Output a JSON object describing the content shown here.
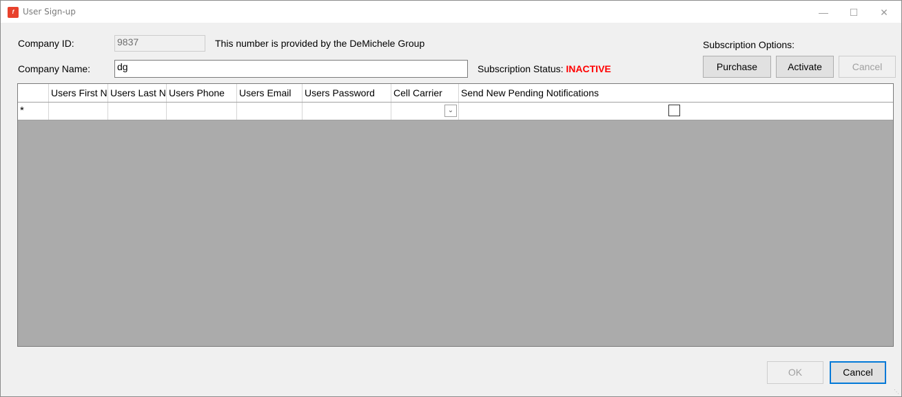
{
  "window": {
    "title": "User Sign-up",
    "app_icon_text": "f"
  },
  "form": {
    "company_id_label": "Company ID:",
    "company_id_value": "9837",
    "company_id_note": "This number is provided by the DeMichele Group",
    "company_name_label": "Company Name:",
    "company_name_value": "dg",
    "subscription_status_label": "Subscription Status:",
    "subscription_status_value": "INACTIVE"
  },
  "subscription": {
    "options_label": "Subscription Options:",
    "purchase": "Purchase",
    "activate": "Activate",
    "cancel": "Cancel"
  },
  "grid": {
    "columns": [
      "Users First Name",
      "Users Last Name",
      "Users Phone",
      "Users Email",
      "Users Password",
      "Cell Carrier",
      "Send New Pending Notifications"
    ],
    "new_row_marker": "*",
    "status_color": "#ff0000"
  },
  "footer": {
    "ok": "OK",
    "cancel": "Cancel"
  }
}
